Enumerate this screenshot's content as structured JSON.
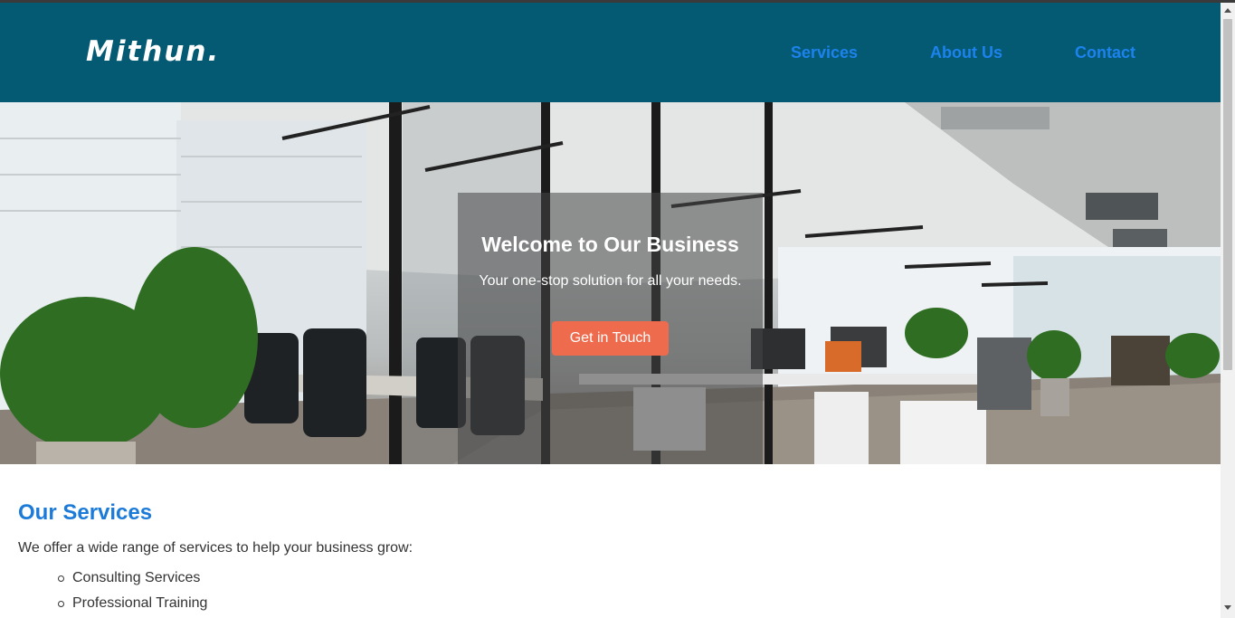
{
  "header": {
    "logo": "Mithun.",
    "nav": [
      "Services",
      "About Us",
      "Contact"
    ],
    "colors": {
      "background": "#055a73",
      "link": "#1c83ee"
    }
  },
  "hero": {
    "title": "Welcome to Our Business",
    "subtitle": "Your one-stop solution for all your needs.",
    "cta_label": "Get in Touch",
    "cta_color": "#ee6b4d"
  },
  "services": {
    "title": "Our Services",
    "description": "We offer a wide range of services to help your business grow:",
    "items": [
      "Consulting Services",
      "Professional Training"
    ]
  }
}
